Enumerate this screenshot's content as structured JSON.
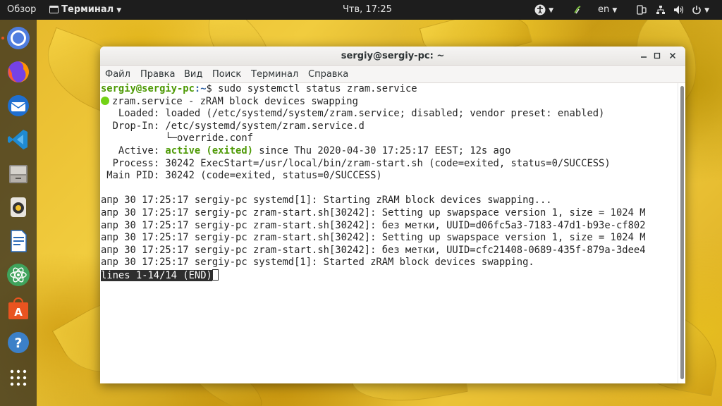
{
  "topbar": {
    "activities": "Обзор",
    "app_menu": "Терминал",
    "clock": "Чтв, 17:25",
    "language": "en",
    "icons": [
      "accessibility-icon",
      "sync-icon",
      "input-language-icon",
      "phone-icon",
      "network-icon",
      "volume-icon",
      "power-icon"
    ]
  },
  "dock": {
    "apps": [
      "chromium-icon",
      "firefox-icon",
      "thunderbird-icon",
      "vscode-icon",
      "files-icon",
      "rhythmbox-icon",
      "writer-icon",
      "atom-icon",
      "software-center-icon",
      "help-icon",
      "show-apps-icon"
    ]
  },
  "window": {
    "title": "sergiy@sergiy-pc: ~",
    "buttons": [
      "minimize-icon",
      "maximize-icon",
      "close-icon"
    ]
  },
  "menubar": {
    "items": [
      "Файл",
      "Правка",
      "Вид",
      "Поиск",
      "Терминал",
      "Справка"
    ]
  },
  "terminal": {
    "prompt_user": "sergiy@sergiy-pc",
    "prompt_path": ":~",
    "prompt_symbol": "$ ",
    "command": "sudo systemctl status zram.service",
    "service_name": "zram.service - zRAM block devices swapping",
    "loaded_label": "   Loaded:",
    "loaded_value": " loaded (/etc/systemd/system/zram.service; disabled; vendor preset: enabled)",
    "dropin_label": "  Drop-In:",
    "dropin_value": " /etc/systemd/system/zram.service.d",
    "dropin_file": "           └─override.conf",
    "active_label": "   Active:",
    "active_state": " active (exited)",
    "active_rest": " since Thu 2020-04-30 17:25:17 EEST; 12s ago",
    "process_label": "  Process:",
    "process_value": " 30242 ExecStart=/usr/local/bin/zram-start.sh (code=exited, status=0/SUCCESS)",
    "mainpid_label": " Main PID:",
    "mainpid_value": " 30242 (code=exited, status=0/SUCCESS)",
    "log": [
      "апр 30 17:25:17 sergiy-pc systemd[1]: Starting zRAM block devices swapping...",
      "апр 30 17:25:17 sergiy-pc zram-start.sh[30242]: Setting up swapspace version 1, size = 1024 M",
      "апр 30 17:25:17 sergiy-pc zram-start.sh[30242]: без метки, UUID=d06fc5a3-7183-47d1-b93e-cf802",
      "апр 30 17:25:17 sergiy-pc zram-start.sh[30242]: Setting up swapspace version 1, size = 1024 M",
      "апр 30 17:25:17 sergiy-pc zram-start.sh[30242]: без метки, UUID=cfc21408-0689-435f-879a-3dee4",
      "апр 30 17:25:17 sergiy-pc systemd[1]: Started zRAM block devices swapping."
    ],
    "pager_status": "lines 1-14/14 (END)"
  },
  "colors": {
    "prompt_green": "#4e9a06",
    "prompt_blue": "#3465a4",
    "status_dot": "#73d216",
    "ubuntu_orange": "#e95420"
  }
}
